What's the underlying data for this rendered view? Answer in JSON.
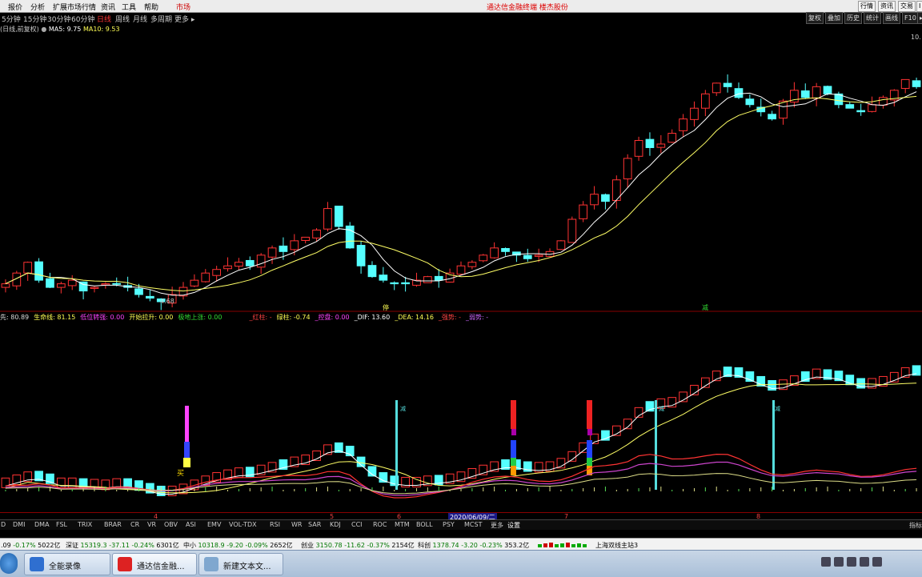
{
  "menu": {
    "items": [
      "报价",
      "分析",
      "扩展市场行情",
      "资讯",
      "工具",
      "帮助"
    ],
    "market": "市场",
    "center_title": "通达信金融终端  楼杰股份",
    "right_buttons": [
      "行情",
      "资讯",
      "交易",
      "I"
    ]
  },
  "toolbar": {
    "timeframes": [
      "5分钟",
      "15分钟",
      "30分钟",
      "60分钟",
      "日线",
      "周线",
      "月线",
      "多周期",
      "更多 ▸"
    ],
    "active_timeframe": "日线",
    "right_buttons": [
      "复权",
      "叠加",
      "历史",
      "统计",
      "画线",
      "F10",
      "▸"
    ]
  },
  "price_panel": {
    "info": "(日线,前复权)",
    "ma5": "MA5: 9.75",
    "ma10": "MA10: 9.53",
    "top_price": "10.",
    "low_label": "4.68",
    "marker_left": "停",
    "marker_right": "减"
  },
  "indicator": {
    "labels": [
      {
        "text": "先: 80.89",
        "color": "#dddddd"
      },
      {
        "text": "生命线: 81.15",
        "color": "#ffff55"
      },
      {
        "text": "低位转强: 0.00",
        "color": "#ff44ff"
      },
      {
        "text": "开始拉升: 0.00",
        "color": "#ffff55"
      },
      {
        "text": "极地上涨: 0.00",
        "color": "#33dd33"
      },
      {
        "text": "_红柱: -",
        "color": "#ff4444"
      },
      {
        "text": "绿柱: -0.74",
        "color": "#ffff55"
      },
      {
        "text": "_控盘: 0.00",
        "color": "#ff44ff"
      },
      {
        "text": "_DIF: 13.60",
        "color": "#ffffff"
      },
      {
        "text": "_DEA: 14.16",
        "color": "#ffff55"
      },
      {
        "text": "_强势: -",
        "color": "#ff4444"
      },
      {
        "text": "_弱势: -",
        "color": "#cc66ff"
      }
    ],
    "signal_text": "减",
    "bottom_text": "买"
  },
  "date_axis": {
    "labels": [
      "4",
      "5",
      "6",
      "7",
      "8"
    ],
    "highlight": "2020/06/09/二"
  },
  "indicator_tabs": {
    "items": [
      "D",
      "DMI",
      "DMA",
      "FSL",
      "TRIX",
      "BRAR",
      "CR",
      "VR",
      "OBV",
      "ASI",
      "EMV",
      "VOL-TDX",
      "RSI",
      "WR",
      "SAR",
      "KDJ",
      "CCI",
      "ROC",
      "MTM",
      "BOLL",
      "PSY",
      "MCST",
      "更多",
      "设置"
    ],
    "active": "设置",
    "right_label": "指标"
  },
  "status": {
    "indices": [
      {
        "name": "",
        "value": ".09",
        "chg": "-0.17%",
        "amt": "5022亿"
      },
      {
        "name": "深证",
        "value": "15319.3",
        "diff": "-37.11",
        "chg": "-0.24%",
        "amt": "6301亿"
      },
      {
        "name": "中小",
        "value": "10318.9",
        "diff": "-9.20",
        "chg": "-0.09%",
        "amt": "2652亿"
      },
      {
        "name": "创业",
        "value": "3150.78",
        "diff": "-11.62",
        "chg": "-0.37%",
        "amt": "2154亿"
      },
      {
        "name": "科创",
        "value": "1378.74",
        "diff": "-3.20",
        "chg": "-0.23%",
        "amt": "353.2亿"
      }
    ],
    "server": "上海双线主站3"
  },
  "taskbar": {
    "items": [
      "全能录像",
      "通达信金融...",
      "新建文本文..."
    ]
  },
  "chart_data": {
    "type": "candlestick",
    "series_labels": [
      "MA5: 9.75",
      "MA10: 9.53"
    ],
    "close": [
      5.0,
      5.3,
      5.6,
      5.1,
      4.9,
      5.0,
      5.1,
      4.8,
      4.9,
      5.0,
      5.0,
      4.9,
      4.7,
      4.6,
      4.5,
      4.7,
      4.9,
      5.1,
      5.3,
      5.4,
      5.5,
      5.6,
      5.5,
      5.8,
      6.0,
      5.9,
      6.2,
      6.3,
      6.5,
      7.1,
      6.6,
      6.0,
      5.5,
      5.2,
      5.1,
      5.0,
      5.0,
      5.1,
      5.2,
      5.1,
      5.3,
      5.5,
      5.6,
      5.8,
      6.0,
      5.9,
      5.8,
      5.7,
      5.8,
      5.9,
      6.2,
      6.8,
      7.2,
      7.5,
      7.3,
      7.9,
      8.5,
      9.0,
      8.8,
      8.9,
      9.2,
      9.6,
      9.9,
      10.3,
      10.6,
      10.5,
      10.2,
      10.0,
      9.8,
      9.6,
      10.1,
      10.4,
      10.2,
      10.5,
      10.3,
      10.0,
      9.9,
      9.8,
      10.0,
      10.2,
      10.4,
      10.7,
      10.5
    ],
    "price_min": 4.5,
    "price_max": 11.2
  }
}
